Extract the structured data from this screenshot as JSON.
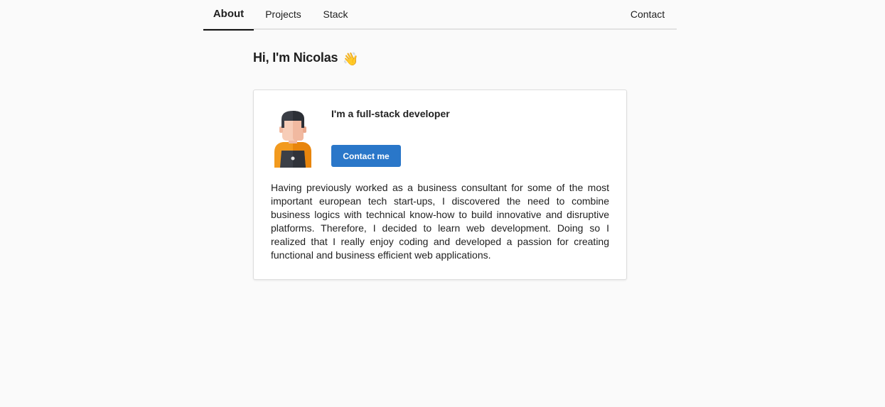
{
  "nav": {
    "tabs": [
      {
        "label": "About",
        "active": true
      },
      {
        "label": "Projects",
        "active": false
      },
      {
        "label": "Stack",
        "active": false
      }
    ],
    "contact_label": "Contact"
  },
  "greeting": {
    "text": "Hi, I'm Nicolas",
    "emoji": "👋"
  },
  "card": {
    "avatar_icon": "developer-avatar-icon",
    "headline": "I'm a full-stack developer",
    "button_label": "Contact me",
    "bio": "Having previously worked as a business consultant for some of the most important european tech start-ups, I discovered the need to combine business logics with technical know-how to build innovative and disruptive platforms. Therefore, I decided to learn web development. Doing so I realized that I really enjoy coding and developed a passion for creating functional and business efficient web applications."
  },
  "colors": {
    "accent": "#2a77c9",
    "background": "#fafafa",
    "card": "#ffffff"
  }
}
